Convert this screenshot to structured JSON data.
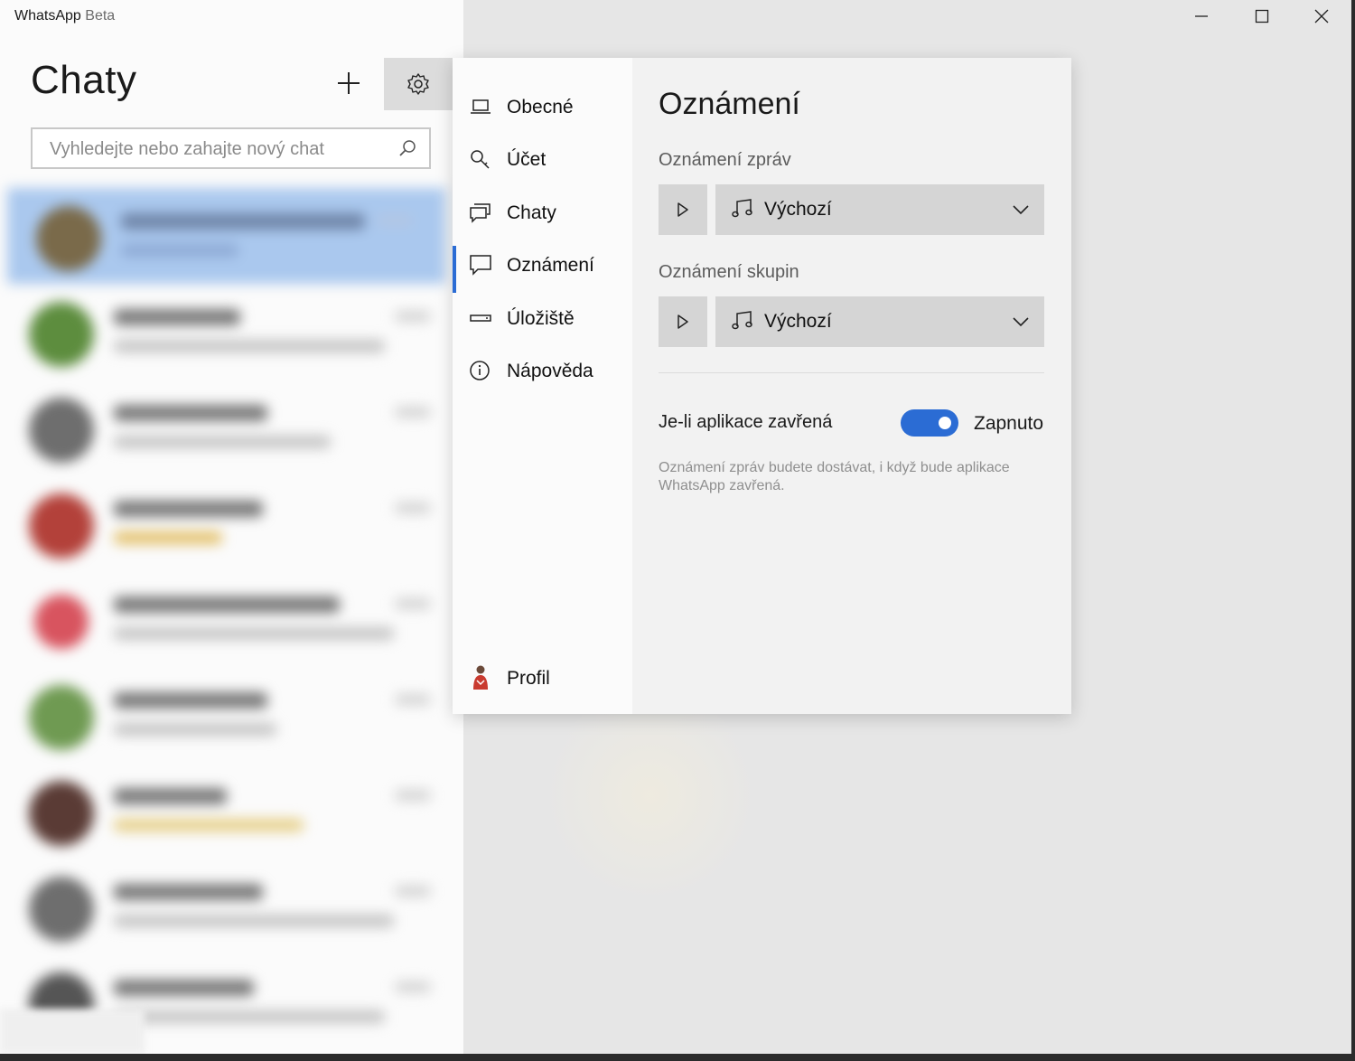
{
  "window": {
    "app_name": "WhatsApp",
    "app_suffix": "Beta",
    "controls": [
      "minimize-icon",
      "maximize-icon",
      "close-icon"
    ]
  },
  "sidebar": {
    "title": "Chaty",
    "search_placeholder": "Vyhledejte nebo zahajte nový chat",
    "chats_blurred": true,
    "chat_count_visible": 9
  },
  "settings": {
    "nav": [
      {
        "label": "Obecné",
        "icon": "laptop-icon"
      },
      {
        "label": "Účet",
        "icon": "key-icon"
      },
      {
        "label": "Chaty",
        "icon": "chat-bubbles-icon"
      },
      {
        "label": "Oznámení",
        "icon": "notification-icon",
        "selected": true
      },
      {
        "label": "Úložiště",
        "icon": "storage-icon"
      },
      {
        "label": "Nápověda",
        "icon": "info-icon"
      }
    ],
    "profile_label": "Profil",
    "page_title": "Oznámení",
    "message_notifications": {
      "label": "Oznámení zpráv",
      "sound": "Výchozí"
    },
    "group_notifications": {
      "label": "Oznámení skupin",
      "sound": "Výchozí"
    },
    "when_closed": {
      "label": "Je-li aplikace zavřená",
      "state": "Zapnuto",
      "on": true,
      "help": "Oznámení zpráv budete dostávat, i když bude aplikace WhatsApp zavřená."
    }
  },
  "colors": {
    "accent": "#2b6cd4",
    "active_chat": "#aac8ee",
    "settings_button_bg": "#dcdcdc"
  }
}
